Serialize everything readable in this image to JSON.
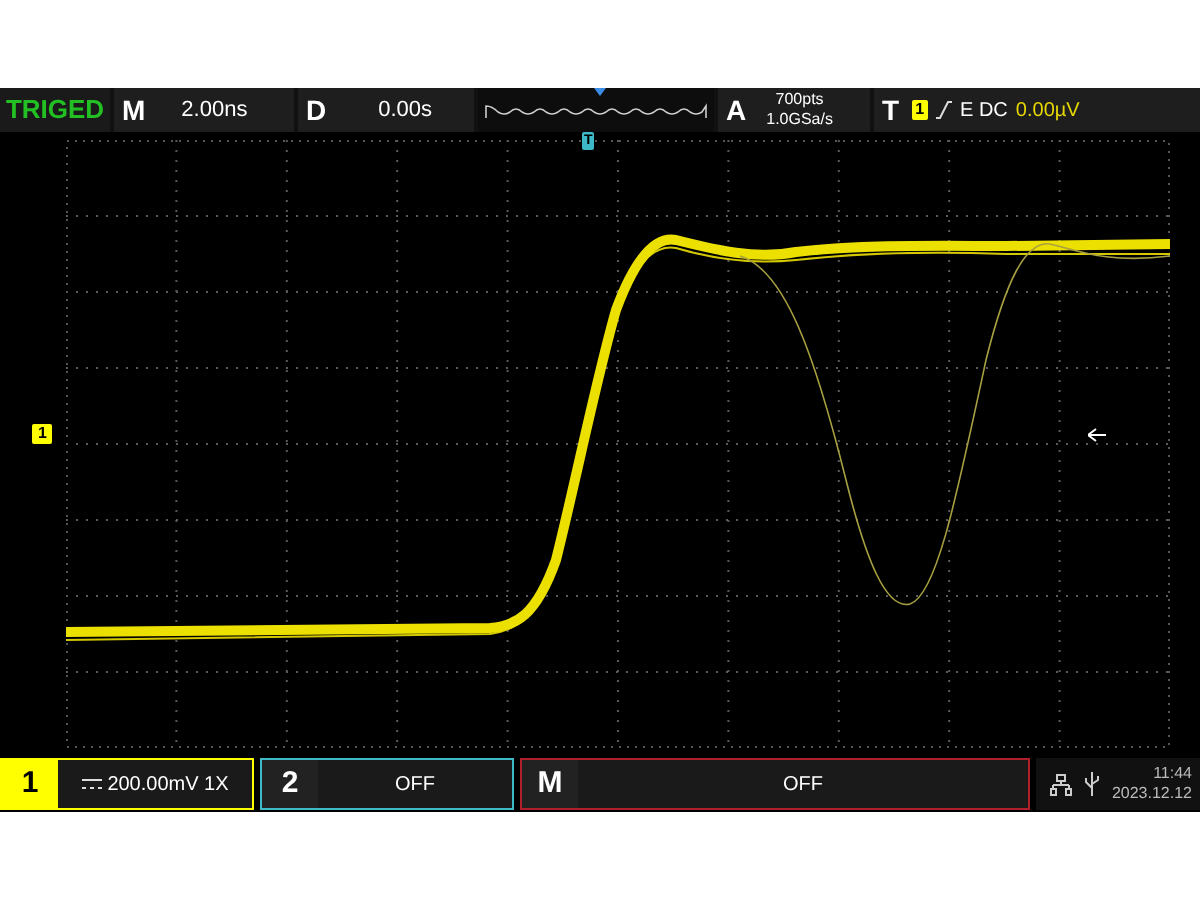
{
  "status": {
    "text": "TRIGED",
    "triggered": true
  },
  "timebase": {
    "label": "M",
    "value": "2.00ns"
  },
  "delay": {
    "label": "D",
    "value": "0.00s"
  },
  "acquire": {
    "label": "A",
    "points": "700pts",
    "rate": "1.0GSa/s"
  },
  "trigger": {
    "label": "T",
    "source": "1",
    "mode": "E DC",
    "level": "0.00µV"
  },
  "plot": {
    "trigger_marker": "T",
    "channel_marker": "1"
  },
  "channels": [
    {
      "number": "1",
      "text": "200.00mV 1X",
      "active": true,
      "color": "#ffff00"
    },
    {
      "number": "2",
      "text": "OFF",
      "active": false,
      "color": "#3fb8c8"
    },
    {
      "number": "M",
      "text": "OFF",
      "active": false,
      "color": "#b0202c"
    }
  ],
  "status_bar": {
    "time": "11:44",
    "date": "2023.12.12"
  }
}
